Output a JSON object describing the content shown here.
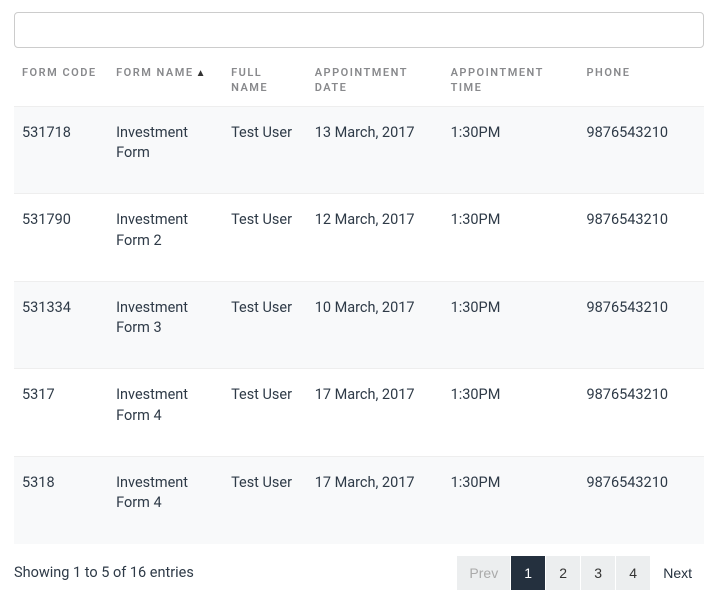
{
  "search": {
    "value": ""
  },
  "columns": {
    "form_code": "FORM CODE",
    "form_name": "FORM NAME",
    "full_name": "FULL NAME",
    "appt_date": "APPOINTMENT DATE",
    "appt_time": "APPOINTMENT TIME",
    "phone": "PHONE"
  },
  "sort_indicator": "▲",
  "rows": [
    {
      "code": "531718",
      "name": "Investment Form",
      "user": "Test User",
      "date": "13 March, 2017",
      "time": "1:30PM",
      "phone": "9876543210"
    },
    {
      "code": "531790",
      "name": "Investment Form 2",
      "user": "Test User",
      "date": "12 March, 2017",
      "time": "1:30PM",
      "phone": "9876543210"
    },
    {
      "code": "531334",
      "name": "Investment Form 3",
      "user": "Test User",
      "date": "10 March, 2017",
      "time": "1:30PM",
      "phone": "9876543210"
    },
    {
      "code": "5317",
      "name": "Investment Form 4",
      "user": "Test User",
      "date": "17 March, 2017",
      "time": "1:30PM",
      "phone": "9876543210"
    },
    {
      "code": "5318",
      "name": "Investment Form 4",
      "user": "Test User",
      "date": "17 March, 2017",
      "time": "1:30PM",
      "phone": "9876543210"
    }
  ],
  "footer": {
    "info": "Showing 1 to 5 of 16 entries",
    "prev": "Prev",
    "next": "Next",
    "pages": [
      "1",
      "2",
      "3",
      "4"
    ],
    "active_page": "1"
  }
}
